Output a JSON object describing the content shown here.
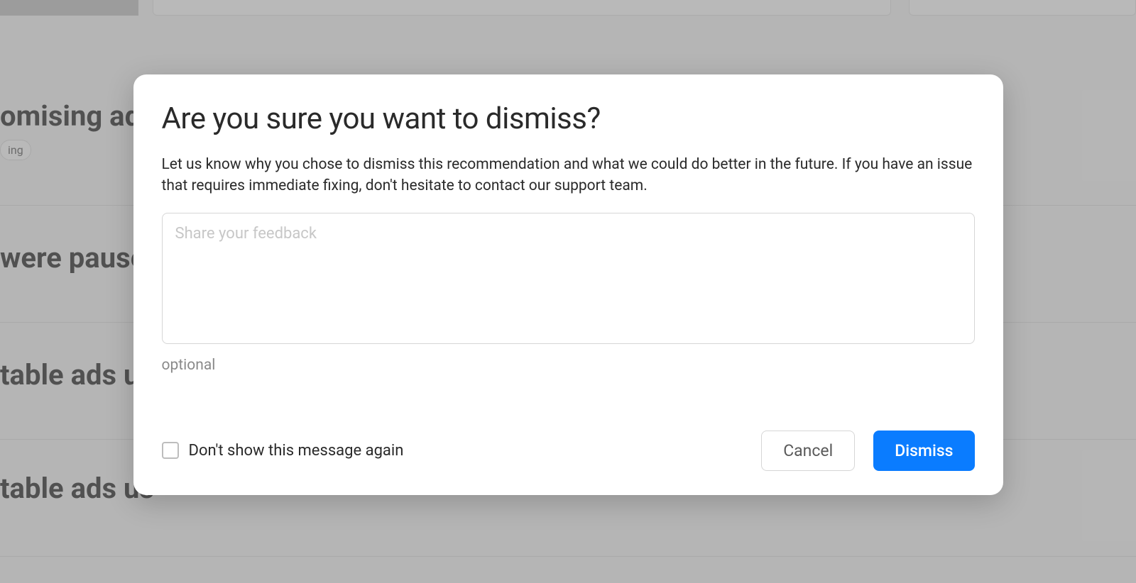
{
  "background": {
    "rows": [
      {
        "heading": "omising ads",
        "tag": "ing"
      },
      {
        "heading": "were pause"
      },
      {
        "heading": "table ads us"
      },
      {
        "heading": "table ads us"
      }
    ]
  },
  "modal": {
    "title": "Are you sure you want to dismiss?",
    "body": "Let us know why you chose to dismiss this recommendation and what we could do better in the future. If you have an issue that requires immediate fixing, don't hesitate to contact our support team.",
    "feedback_placeholder": "Share your feedback",
    "feedback_value": "",
    "optional_hint": "optional",
    "checkbox_label": "Don't show this message again",
    "cancel_label": "Cancel",
    "dismiss_label": "Dismiss"
  }
}
